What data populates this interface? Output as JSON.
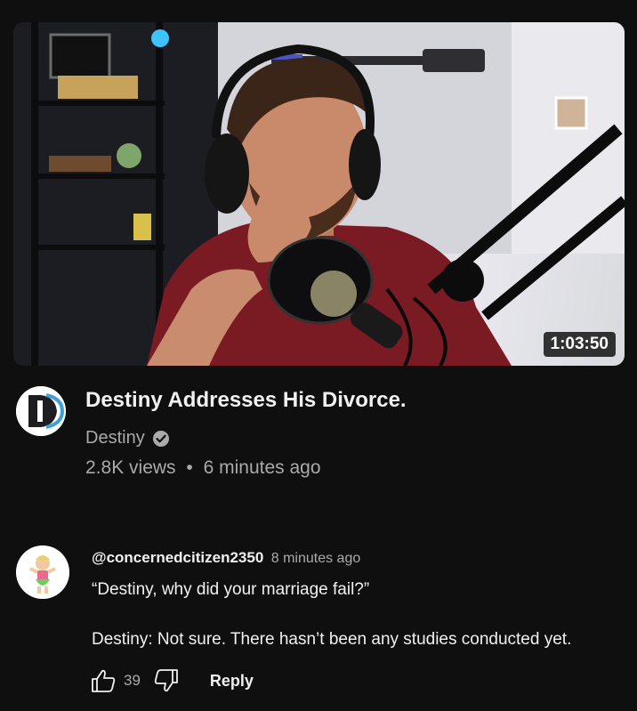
{
  "video": {
    "duration": "1:03:50",
    "title": "Destiny Addresses His Divorce.",
    "channel": "Destiny",
    "views": "2.8K views",
    "separator": "•",
    "age": "6 minutes ago"
  },
  "comment": {
    "author": "@concernedcitizen2350",
    "time": "8 minutes ago",
    "line1": "“Destiny, why did your marriage fail?”",
    "line2": "Destiny: Not sure. There hasn’t been any studies conducted yet.",
    "likes": "39",
    "reply_label": "Reply"
  },
  "icons": {
    "verified": "verified-check-icon",
    "like": "thumbs-up-icon",
    "dislike": "thumbs-down-icon"
  },
  "colors": {
    "background": "#0f0f0f",
    "primary_text": "#f1f1f1",
    "secondary_text": "#aaaaaa",
    "channel_logo_blue": "#3fa0d8"
  }
}
